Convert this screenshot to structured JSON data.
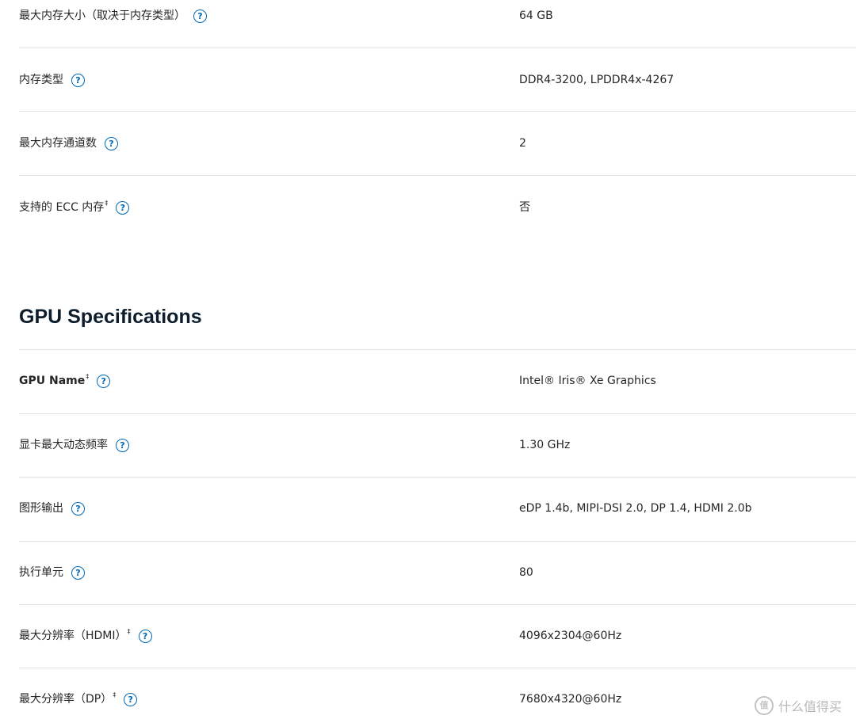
{
  "memory": {
    "rows": [
      {
        "label": "最大内存大小（取决于内存类型）",
        "value": "64 GB"
      },
      {
        "label": "内存类型",
        "value": "DDR4-3200, LPDDR4x-4267"
      },
      {
        "label": "最大内存通道数",
        "value": "2"
      },
      {
        "label": "支持的 ECC 内存",
        "label_sup": "‡",
        "value": "否"
      }
    ]
  },
  "gpu": {
    "title": "GPU Specifications",
    "rows": [
      {
        "label": "GPU Name",
        "label_sup": "‡",
        "value": "Intel® Iris® Xe Graphics"
      },
      {
        "label": "显卡最大动态频率",
        "value": "1.30 GHz"
      },
      {
        "label": "图形输出",
        "value": "eDP 1.4b, MIPI-DSI 2.0, DP 1.4, HDMI 2.0b"
      },
      {
        "label": "执行单元",
        "value": "80"
      },
      {
        "label": "最大分辨率（HDMI）",
        "label_sup": "‡",
        "value": "4096x2304@60Hz"
      },
      {
        "label": "最大分辨率（DP）",
        "label_sup": "‡",
        "value": "7680x4320@60Hz"
      }
    ]
  },
  "help_icon_glyph": "?",
  "watermark": {
    "logo_glyph": "值",
    "text": "什么值得买"
  },
  "colors": {
    "accent": "#0068b5",
    "separator": "#e2e2e2",
    "text": "#262626"
  }
}
